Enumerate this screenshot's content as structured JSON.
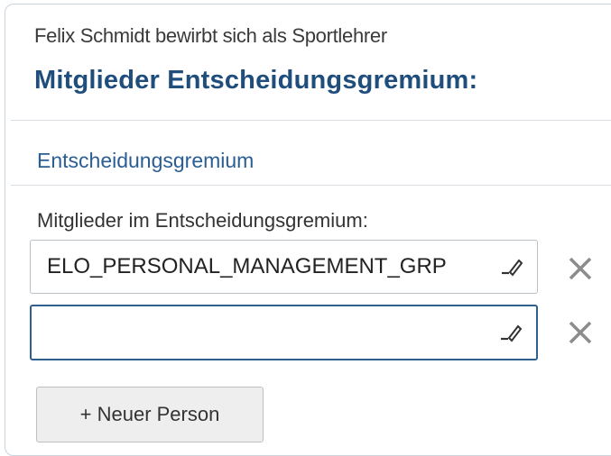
{
  "header": {
    "subtitle": "Felix Schmidt bewirbt sich als Sportlehrer",
    "title": "Mitglieder Entscheidungsgremium:"
  },
  "section": {
    "title": "Entscheidungsgremium"
  },
  "members": {
    "label": "Mitglieder im Entscheidungsgremium:",
    "entries": [
      {
        "value": "ELO_PERSONAL_MANAGEMENT_GRP"
      },
      {
        "value": ""
      }
    ],
    "add_label": "+ Neuer Person"
  },
  "icons": {
    "edit": "pencil-icon",
    "remove": "close-icon"
  },
  "colors": {
    "title": "#1f4d7c",
    "section": "#2a5e93",
    "focus_border": "#2f5f8f",
    "remove_icon": "#8c8c8c"
  }
}
